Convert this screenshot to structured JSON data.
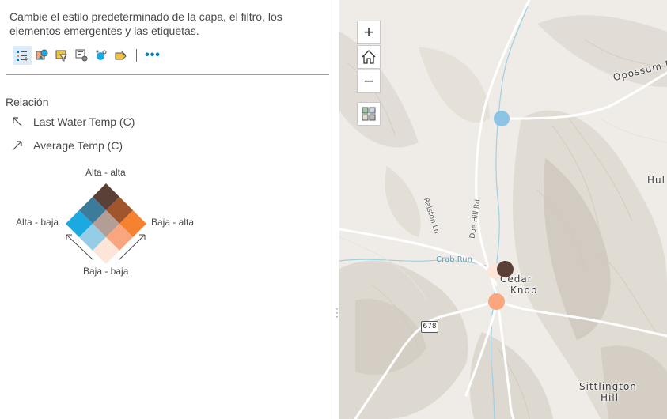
{
  "panel": {
    "description": "Cambie el estilo predeterminado de la capa, el filtro, los elementos emergentes y las etiquetas.",
    "toolbar": [
      {
        "icon": "legend-list-icon",
        "active": true
      },
      {
        "icon": "styles-icon",
        "active": false
      },
      {
        "icon": "filter-icon",
        "active": false
      },
      {
        "icon": "popups-icon",
        "active": false
      },
      {
        "icon": "clustering-icon",
        "active": false
      },
      {
        "icon": "labels-icon",
        "active": false
      },
      {
        "icon": "more-options-icon",
        "active": false
      }
    ],
    "more_label": "•••"
  },
  "legend": {
    "title": "Relación",
    "field_1": "Last Water Temp (C)",
    "field_2": "Average Temp (C)",
    "label_top": "Alta - alta",
    "label_left": "Alta - baja",
    "label_right": "Baja - alta",
    "label_bottom": "Baja - baja",
    "grid_colors": [
      [
        "#5a4036",
        "#a0552c",
        "#f58230"
      ],
      [
        "#3c7b99",
        "#b49d94",
        "#f9a67e"
      ],
      [
        "#1ca8e0",
        "#95cde6",
        "#fde6d9"
      ]
    ]
  },
  "map": {
    "controls": {
      "zoom_in": "+",
      "zoom_out": "−"
    },
    "places": {
      "cedar_knob_1": "Cedar",
      "cedar_knob_2": "Knob",
      "sittlington_1": "Sittlington",
      "sittlington_2": "Hill",
      "opossum": "Opossum R",
      "hul": "Hul"
    },
    "roads": {
      "ralston": "Ralston Ln",
      "doe_hill": "Doe Hill Rd",
      "crab_run": "Crab Run",
      "route": "678"
    },
    "points": [
      {
        "color": "#8cc4e6"
      },
      {
        "color": "#fde6d9"
      },
      {
        "color": "#5a4036"
      },
      {
        "color": "#f9a67e"
      }
    ]
  }
}
